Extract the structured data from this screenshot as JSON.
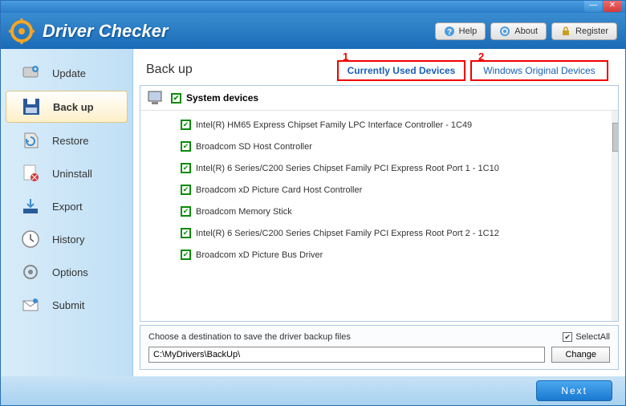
{
  "header": {
    "title": "Driver Checker",
    "help": "Help",
    "about": "About",
    "register": "Register"
  },
  "sidebar": {
    "items": [
      {
        "label": "Update"
      },
      {
        "label": "Back up"
      },
      {
        "label": "Restore"
      },
      {
        "label": "Uninstall"
      },
      {
        "label": "Export"
      },
      {
        "label": "History"
      },
      {
        "label": "Options"
      },
      {
        "label": "Submit"
      }
    ]
  },
  "annotations": [
    "1",
    "2"
  ],
  "content": {
    "title": "Back up",
    "tabs": [
      {
        "label": "Currently Used Devices",
        "active": true
      },
      {
        "label": "Windows Original Devices",
        "active": false
      }
    ],
    "category": "System devices",
    "devices": [
      "Intel(R) HM65 Express Chipset Family LPC Interface Controller - 1C49",
      "Broadcom SD Host Controller",
      "Intel(R) 6 Series/C200 Series Chipset Family PCI Express Root Port 1 - 1C10",
      "Broadcom xD Picture Card Host Controller",
      "Broadcom Memory Stick",
      "Intel(R) 6 Series/C200 Series Chipset Family PCI Express Root Port 2 - 1C12",
      "Broadcom xD Picture Bus Driver"
    ],
    "dest_label": "Choose a destination to save the driver backup files",
    "select_all": "SelectAll",
    "dest_path": "C:\\MyDrivers\\BackUp\\",
    "change_btn": "Change"
  },
  "footer": {
    "next": "Next"
  }
}
